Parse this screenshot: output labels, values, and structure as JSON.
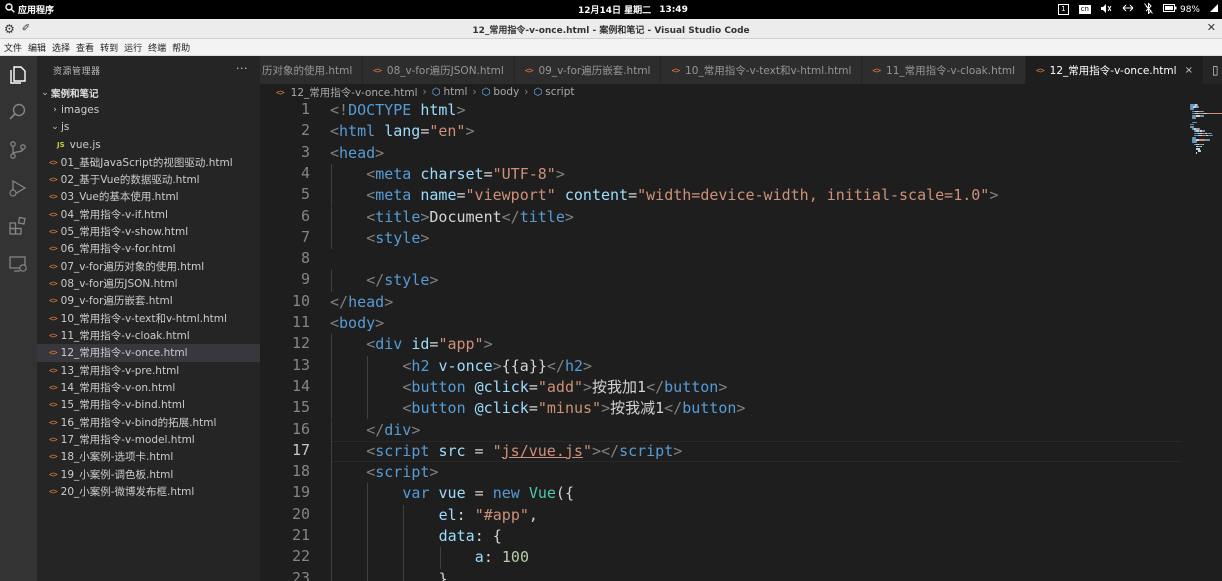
{
  "system_bar": {
    "apps_label": "应用程序",
    "date": "12月14日 星期二",
    "time": "13:49",
    "input_method": "cn",
    "workspace": "1",
    "battery": "98%"
  },
  "window": {
    "title": "12_常用指令-v-once.html - 案例和笔记 - Visual Studio Code"
  },
  "menu": [
    "文件",
    "编辑",
    "选择",
    "查看",
    "转到",
    "运行",
    "终端",
    "帮助"
  ],
  "sidebar": {
    "header": "资源管理器",
    "more": "···",
    "project": "案例和笔记",
    "folders": [
      {
        "name": "images",
        "expanded": false
      },
      {
        "name": "js",
        "expanded": true
      }
    ],
    "js_file": {
      "name": "vue.js",
      "icon_label": "JS"
    },
    "files": [
      "01_基础JavaScript的视图驱动.html",
      "02_基于Vue的数据驱动.html",
      "03_Vue的基本使用.html",
      "04_常用指令-v-if.html",
      "05_常用指令-v-show.html",
      "06_常用指令-v-for.html",
      "07_v-for遍历对象的使用.html",
      "08_v-for遍历JSON.html",
      "09_v-for遍历嵌套.html",
      "10_常用指令-v-text和v-html.html",
      "11_常用指令-v-cloak.html",
      "12_常用指令-v-once.html",
      "13_常用指令-v-pre.html",
      "14_常用指令-v-on.html",
      "15_常用指令-v-bind.html",
      "16_常用指令-v-bind的拓展.html",
      "17_常用指令-v-model.html",
      "18_小案例-选项卡.html",
      "19_小案例-调色板.html",
      "20_小案例-微博发布框.html"
    ],
    "selected_file_index": 11
  },
  "tabs": [
    {
      "label": "历对象的使用.html",
      "active": false,
      "icon": false
    },
    {
      "label": "08_v-for遍历JSON.html",
      "active": false,
      "icon": true
    },
    {
      "label": "09_v-for遍历嵌套.html",
      "active": false,
      "icon": true
    },
    {
      "label": "10_常用指令-v-text和v-html.html",
      "active": false,
      "icon": true
    },
    {
      "label": "11_常用指令-v-cloak.html",
      "active": false,
      "icon": true
    },
    {
      "label": "12_常用指令-v-once.html",
      "active": true,
      "icon": true,
      "close": "×"
    }
  ],
  "breadcrumb": [
    "12_常用指令-v-once.html",
    "html",
    "body",
    "script"
  ],
  "editor": {
    "current_line": 17,
    "lines": [
      {
        "n": 1,
        "ind": 0,
        "t": [
          [
            "br",
            "<!"
          ],
          [
            "tag",
            "DOCTYPE"
          ],
          [
            "txt",
            " "
          ],
          [
            "attr",
            "html"
          ],
          [
            "br",
            ">"
          ]
        ]
      },
      {
        "n": 2,
        "ind": 0,
        "t": [
          [
            "br",
            "<"
          ],
          [
            "tag",
            "html"
          ],
          [
            "txt",
            " "
          ],
          [
            "attr",
            "lang"
          ],
          [
            "txt",
            "="
          ],
          [
            "str",
            "\"en\""
          ],
          [
            "br",
            ">"
          ]
        ]
      },
      {
        "n": 3,
        "ind": 0,
        "t": [
          [
            "br",
            "<"
          ],
          [
            "tag",
            "head"
          ],
          [
            "br",
            ">"
          ]
        ]
      },
      {
        "n": 4,
        "ind": 1,
        "t": [
          [
            "br",
            "<"
          ],
          [
            "tag",
            "meta"
          ],
          [
            "txt",
            " "
          ],
          [
            "attr",
            "charset"
          ],
          [
            "txt",
            "="
          ],
          [
            "str",
            "\"UTF-8\""
          ],
          [
            "br",
            ">"
          ]
        ]
      },
      {
        "n": 5,
        "ind": 1,
        "t": [
          [
            "br",
            "<"
          ],
          [
            "tag",
            "meta"
          ],
          [
            "txt",
            " "
          ],
          [
            "attr",
            "name"
          ],
          [
            "txt",
            "="
          ],
          [
            "str",
            "\"viewport\""
          ],
          [
            "txt",
            " "
          ],
          [
            "attr",
            "content"
          ],
          [
            "txt",
            "="
          ],
          [
            "str",
            "\"width=device-width, initial-scale=1.0\""
          ],
          [
            "br",
            ">"
          ]
        ]
      },
      {
        "n": 6,
        "ind": 1,
        "t": [
          [
            "br",
            "<"
          ],
          [
            "tag",
            "title"
          ],
          [
            "br",
            ">"
          ],
          [
            "txt",
            "Document"
          ],
          [
            "br",
            "</"
          ],
          [
            "tag",
            "title"
          ],
          [
            "br",
            ">"
          ]
        ]
      },
      {
        "n": 7,
        "ind": 1,
        "t": [
          [
            "br",
            "<"
          ],
          [
            "tag",
            "style"
          ],
          [
            "br",
            ">"
          ]
        ]
      },
      {
        "n": 8,
        "ind": 0,
        "t": []
      },
      {
        "n": 9,
        "ind": 1,
        "t": [
          [
            "br",
            "</"
          ],
          [
            "tag",
            "style"
          ],
          [
            "br",
            ">"
          ]
        ]
      },
      {
        "n": 10,
        "ind": 0,
        "t": [
          [
            "br",
            "</"
          ],
          [
            "tag",
            "head"
          ],
          [
            "br",
            ">"
          ]
        ]
      },
      {
        "n": 11,
        "ind": 0,
        "t": [
          [
            "br",
            "<"
          ],
          [
            "tag",
            "body"
          ],
          [
            "br",
            ">"
          ]
        ]
      },
      {
        "n": 12,
        "ind": 1,
        "t": [
          [
            "br",
            "<"
          ],
          [
            "tag",
            "div"
          ],
          [
            "txt",
            " "
          ],
          [
            "attr",
            "id"
          ],
          [
            "txt",
            "="
          ],
          [
            "str",
            "\"app\""
          ],
          [
            "br",
            ">"
          ]
        ]
      },
      {
        "n": 13,
        "ind": 2,
        "t": [
          [
            "br",
            "<"
          ],
          [
            "tag",
            "h2"
          ],
          [
            "txt",
            " "
          ],
          [
            "attr",
            "v-once"
          ],
          [
            "br",
            ">"
          ],
          [
            "txt",
            "{{a}}"
          ],
          [
            "br",
            "</"
          ],
          [
            "tag",
            "h2"
          ],
          [
            "br",
            ">"
          ]
        ]
      },
      {
        "n": 14,
        "ind": 2,
        "t": [
          [
            "br",
            "<"
          ],
          [
            "tag",
            "button"
          ],
          [
            "txt",
            " "
          ],
          [
            "attr",
            "@click"
          ],
          [
            "txt",
            "="
          ],
          [
            "str",
            "\"add\""
          ],
          [
            "br",
            ">"
          ],
          [
            "txt",
            "按我加1"
          ],
          [
            "br",
            "</"
          ],
          [
            "tag",
            "button"
          ],
          [
            "br",
            ">"
          ]
        ]
      },
      {
        "n": 15,
        "ind": 2,
        "t": [
          [
            "br",
            "<"
          ],
          [
            "tag",
            "button"
          ],
          [
            "txt",
            " "
          ],
          [
            "attr",
            "@click"
          ],
          [
            "txt",
            "="
          ],
          [
            "str",
            "\"minus\""
          ],
          [
            "br",
            ">"
          ],
          [
            "txt",
            "按我减1"
          ],
          [
            "br",
            "</"
          ],
          [
            "tag",
            "button"
          ],
          [
            "br",
            ">"
          ]
        ]
      },
      {
        "n": 16,
        "ind": 1,
        "t": [
          [
            "br",
            "</"
          ],
          [
            "tag",
            "div"
          ],
          [
            "br",
            ">"
          ]
        ]
      },
      {
        "n": 17,
        "ind": 1,
        "t": [
          [
            "br",
            "<"
          ],
          [
            "tag",
            "script"
          ],
          [
            "txt",
            " "
          ],
          [
            "attr",
            "src"
          ],
          [
            "txt",
            " = "
          ],
          [
            "str",
            "\""
          ],
          [
            "link",
            "js/vue.js"
          ],
          [
            "str",
            "\""
          ],
          [
            "br",
            "></"
          ],
          [
            "tag",
            "script"
          ],
          [
            "br",
            ">"
          ]
        ]
      },
      {
        "n": 18,
        "ind": 1,
        "t": [
          [
            "br",
            "<"
          ],
          [
            "tag",
            "script"
          ],
          [
            "br",
            ">"
          ]
        ]
      },
      {
        "n": 19,
        "ind": 2,
        "t": [
          [
            "kw",
            "var"
          ],
          [
            "txt",
            " "
          ],
          [
            "attr",
            "vue"
          ],
          [
            "txt",
            " = "
          ],
          [
            "kw",
            "new"
          ],
          [
            "txt",
            " "
          ],
          [
            "cls",
            "Vue"
          ],
          [
            "txt",
            "({"
          ]
        ]
      },
      {
        "n": 20,
        "ind": 3,
        "t": [
          [
            "attr",
            "el"
          ],
          [
            "txt",
            ": "
          ],
          [
            "str",
            "\"#app\""
          ],
          [
            "txt",
            ","
          ]
        ]
      },
      {
        "n": 21,
        "ind": 3,
        "t": [
          [
            "attr",
            "data"
          ],
          [
            "txt",
            ": {"
          ]
        ]
      },
      {
        "n": 22,
        "ind": 4,
        "t": [
          [
            "attr",
            "a"
          ],
          [
            "txt",
            ": "
          ],
          [
            "num",
            "100"
          ]
        ]
      },
      {
        "n": 23,
        "ind": 3,
        "t": [
          [
            "txt",
            "}"
          ]
        ]
      }
    ]
  }
}
